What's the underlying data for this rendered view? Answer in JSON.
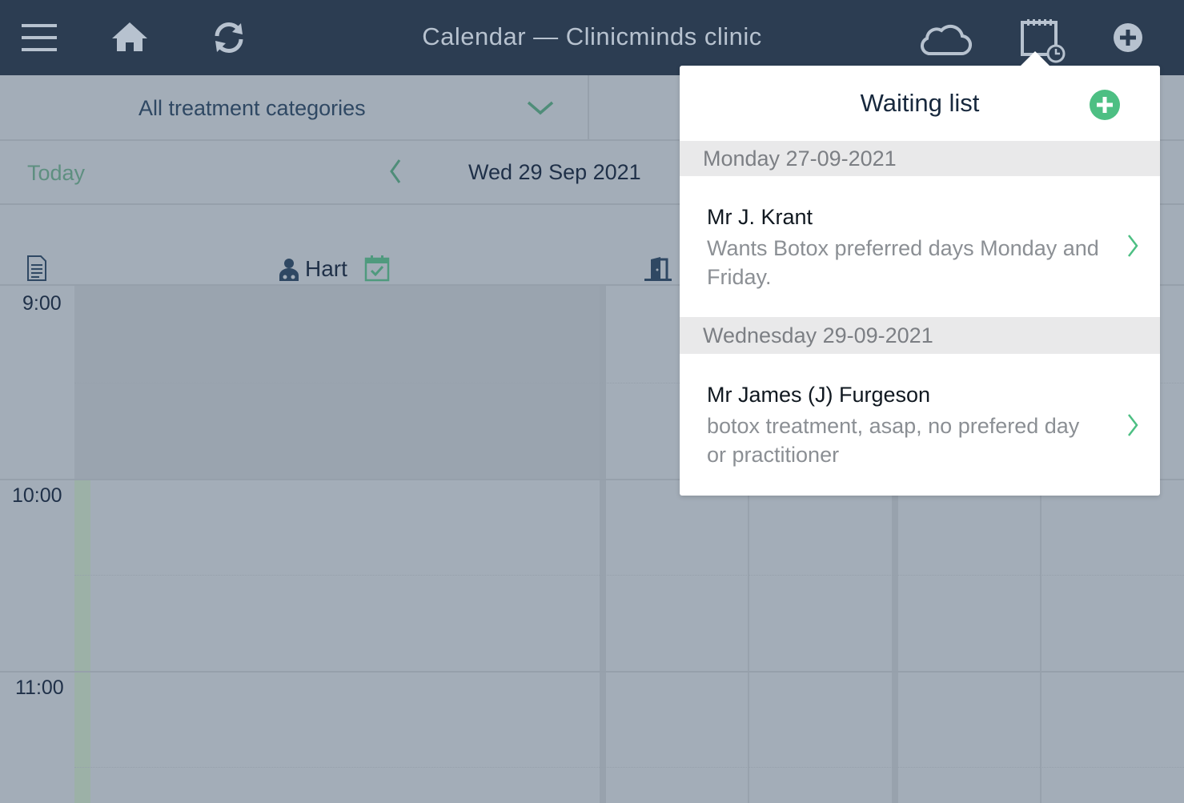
{
  "topbar": {
    "title": "Calendar — Clinicminds clinic",
    "icons": [
      "menu-icon",
      "home-icon",
      "sync-icon",
      "cloud-icon",
      "waiting-list-icon",
      "add-icon"
    ]
  },
  "filter": {
    "category_label": "All treatment categories"
  },
  "date_nav": {
    "today_label": "Today",
    "current_date": "Wed 29 Sep 2021"
  },
  "resources": {
    "practitioner": "Hart"
  },
  "timeline": {
    "hours": [
      "9:00",
      "10:00",
      "11:00"
    ]
  },
  "waiting_list": {
    "title": "Waiting list",
    "groups": [
      {
        "date": "Monday 27-09-2021",
        "entries": [
          {
            "name": "Mr J. Krant",
            "description": "Wants Botox preferred days Monday and Friday."
          }
        ]
      },
      {
        "date": "Wednesday 29-09-2021",
        "entries": [
          {
            "name": "Mr James (J) Furgeson",
            "description": "botox treatment, asap, no prefered day or practitioner"
          }
        ]
      }
    ]
  },
  "colors": {
    "topbar": "#2c3d52",
    "accent_green": "#4dbf83",
    "overlay": "#a3adb8"
  }
}
